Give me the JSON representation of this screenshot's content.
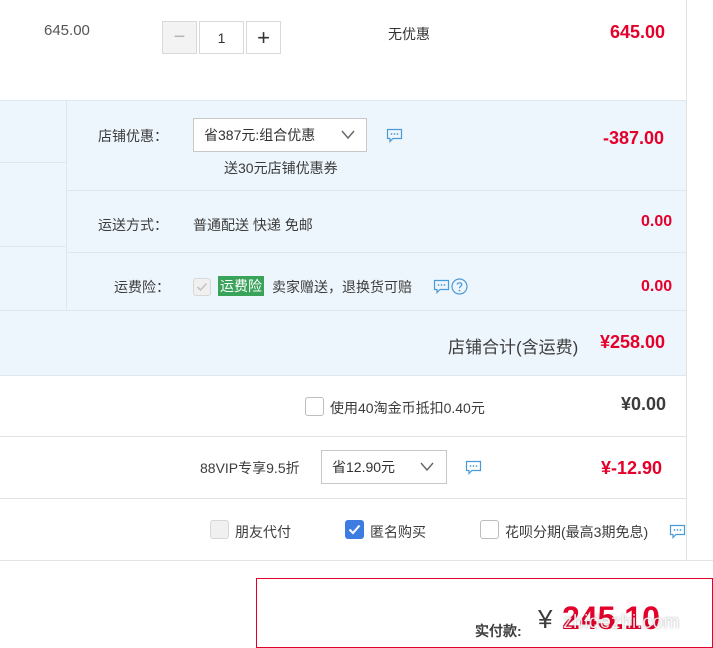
{
  "item": {
    "unit_price": "645.00",
    "quantity": "1",
    "discount": "无优惠",
    "subtotal": "645.00",
    "minus": "−",
    "plus": "+"
  },
  "shop": {
    "promo_label": "店铺优惠：",
    "promo_selected": "省387元:组合优惠",
    "promo_note": "送30元店铺优惠券",
    "promo_amount": "-387.00",
    "shipping_label": "运送方式：",
    "shipping_value": "普通配送 快递 免邮",
    "shipping_amount": "0.00",
    "insurance_label": "运费险：",
    "insurance_tag": "运费险",
    "insurance_text": "卖家赠送，退换货可赔",
    "insurance_amount": "0.00",
    "total_label": "店铺合计(含运费)",
    "total_amount": "¥258.00"
  },
  "coins": {
    "label": "使用40淘金币抵扣0.40元",
    "amount": "¥0.00"
  },
  "vip": {
    "label": "88VIP专享9.5折",
    "selected": "省12.90元",
    "amount": "¥-12.90"
  },
  "options": {
    "friend_pay": "朋友代付",
    "anonymous": "匿名购买",
    "huabei": "花呗分期(最高3期免息)"
  },
  "payment": {
    "label": "实付款:",
    "currency": "¥",
    "amount": "245.10"
  },
  "watermark": "zhidezhi.com",
  "colors": {
    "accent_red": "#e4002b",
    "panel_blue": "#eef6fd",
    "check_blue": "#3d7de2",
    "tag_green": "#3aa35a"
  }
}
